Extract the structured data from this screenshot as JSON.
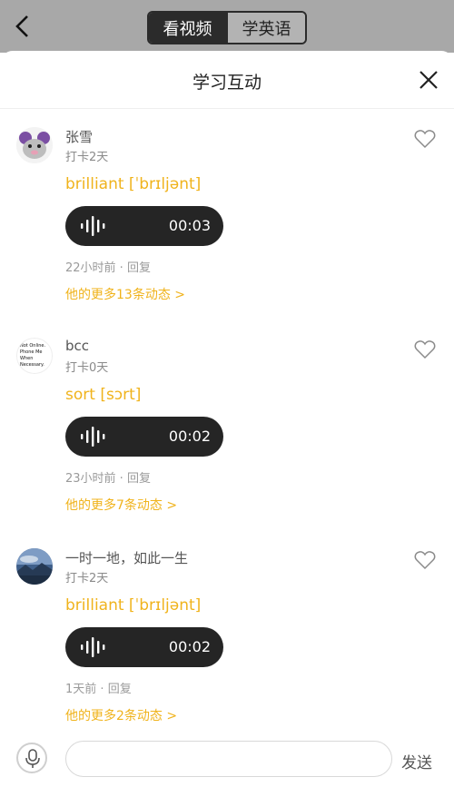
{
  "nav": {
    "tabs": [
      {
        "label": "看视频"
      },
      {
        "label": "学英语"
      }
    ]
  },
  "sheet": {
    "title": "学习互动"
  },
  "posts": [
    {
      "username": "张雪",
      "checkin": "打卡2天",
      "word": "brilliant [ˈbrɪljənt]",
      "duration": "00:03",
      "time": "22小时前 ·",
      "reply": "回复",
      "more": "他的更多13条动态 >"
    },
    {
      "username": "bcc",
      "checkin": "打卡0天",
      "word": "sort [sɔrt]",
      "duration": "00:02",
      "time": "23小时前 ·",
      "reply": "回复",
      "more": "他的更多7条动态 >",
      "avatar_text": "Not Online. Phone Me When Necessary."
    },
    {
      "username": "一时一地，如此一生",
      "checkin": "打卡2天",
      "word": "brilliant [ˈbrɪljənt]",
      "duration": "00:02",
      "time": "1天前 ·",
      "reply": "回复",
      "more": "他的更多2条动态 >"
    }
  ],
  "composer": {
    "placeholder": "",
    "send_label": "发送"
  },
  "colors": {
    "accent": "#f0b31c",
    "voice_bg": "#252525",
    "topbar_bg": "#a8a8a8"
  }
}
